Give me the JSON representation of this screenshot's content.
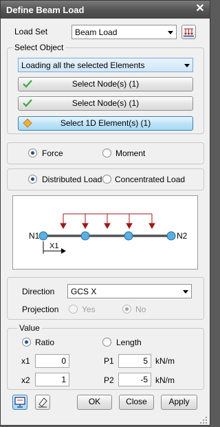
{
  "window": {
    "title": "Define Beam Load"
  },
  "load_set": {
    "label": "Load Set",
    "value": "Beam Load"
  },
  "select_object": {
    "label": "Select Object",
    "mode": "Loading all the selected Elements",
    "buttons": [
      "Select Node(s) (1)",
      "Select Node(s) (1)",
      "Select 1D Element(s) (1)"
    ]
  },
  "load_kind": {
    "force": "Force",
    "moment": "Moment",
    "selected": "force"
  },
  "distribution": {
    "distributed": "Distributed Load",
    "concentrated": "Concentrated Load",
    "selected": "distributed"
  },
  "preview": {
    "n1": "N1",
    "n2": "N2",
    "x1": "X1"
  },
  "direction": {
    "label": "Direction",
    "value": "GCS X"
  },
  "projection": {
    "label": "Projection",
    "yes": "Yes",
    "no": "No",
    "selected": "no"
  },
  "value": {
    "label": "Value",
    "ratio": "Ratio",
    "length": "Length",
    "selected": "ratio",
    "x1_label": "x1",
    "x1": "0",
    "x2_label": "x2",
    "x2": "1",
    "p1_label": "P1",
    "p1": "5",
    "p1_unit": "kN/m",
    "p2_label": "P2",
    "p2": "-5",
    "p2_unit": "kN/m"
  },
  "footer": {
    "ok": "OK",
    "close": "Close",
    "apply": "Apply"
  },
  "colors": {
    "arrow": "#a01818",
    "node": "#5ab0e0",
    "accent": "#3c7fb1"
  }
}
